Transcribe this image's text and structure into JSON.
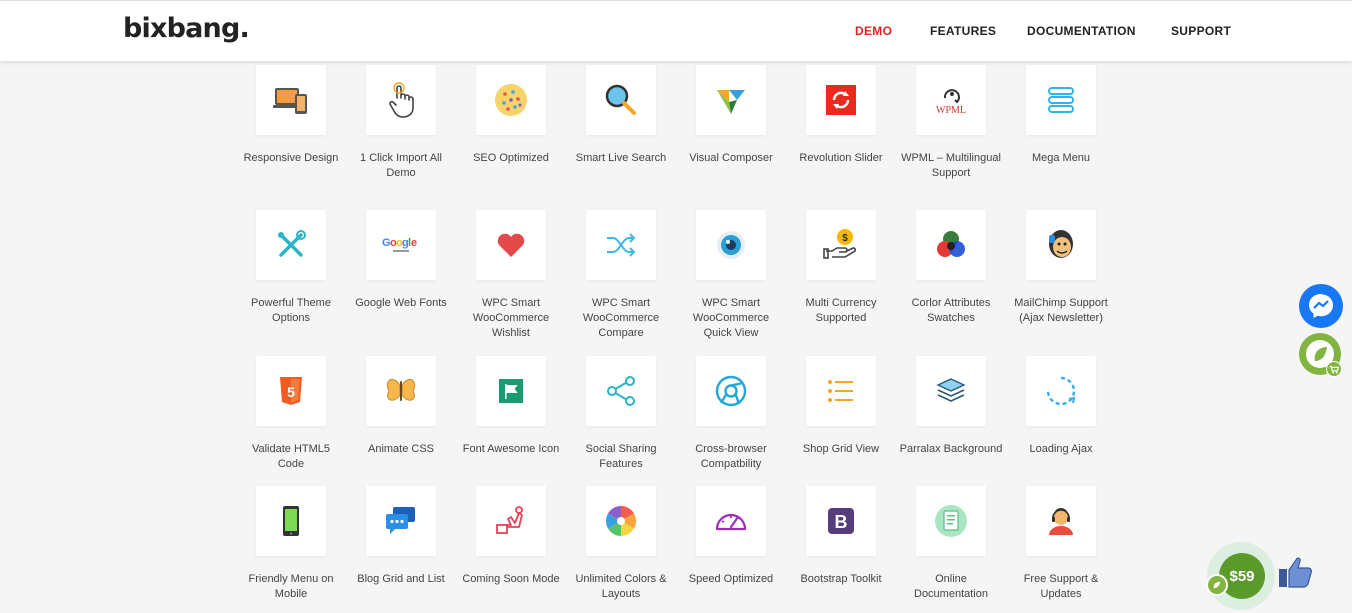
{
  "header": {
    "logo": "bixbang.",
    "nav": [
      "DEMO",
      "FEATURES",
      "DOCUMENTATION",
      "SUPPORT"
    ]
  },
  "features": [
    {
      "label": "Responsive Design",
      "icon": "responsive-icon"
    },
    {
      "label": "1 Click Import All Demo",
      "icon": "click-hand-icon"
    },
    {
      "label": "SEO Optimized",
      "icon": "seo-cookie-icon"
    },
    {
      "label": "Smart Live Search",
      "icon": "magnifier-icon"
    },
    {
      "label": "Visual Composer",
      "icon": "visual-composer-icon"
    },
    {
      "label": "Revolution Slider",
      "icon": "revolution-slider-icon"
    },
    {
      "label": "WPML – Multilingual Support",
      "icon": "wpml-icon"
    },
    {
      "label": "Mega Menu",
      "icon": "mega-menu-icon"
    },
    {
      "label": "Powerful Theme Options",
      "icon": "tools-icon"
    },
    {
      "label": "Google Web Fonts",
      "icon": "google-fonts-icon"
    },
    {
      "label": "WPC Smart WooCommerce Wishlist",
      "icon": "heart-icon"
    },
    {
      "label": "WPC Smart WooCommerce Compare",
      "icon": "shuffle-icon"
    },
    {
      "label": "WPC Smart WooCommerce Quick View",
      "icon": "eye-icon"
    },
    {
      "label": "Multi Currency Supported",
      "icon": "currency-icon"
    },
    {
      "label": "Corlor Attributes Swatches",
      "icon": "color-swatches-icon"
    },
    {
      "label": "MailChimp Support (Ajax Newsletter)",
      "icon": "mailchimp-icon"
    },
    {
      "label": "Validate HTML5 Code",
      "icon": "html5-icon"
    },
    {
      "label": "Animate CSS",
      "icon": "butterfly-icon"
    },
    {
      "label": "Font Awesome Icon",
      "icon": "flag-icon"
    },
    {
      "label": "Social Sharing Features",
      "icon": "share-icon"
    },
    {
      "label": "Cross-browser Compatbility",
      "icon": "browser-icon"
    },
    {
      "label": "Shop Grid View",
      "icon": "list-icon"
    },
    {
      "label": "Parralax Background",
      "icon": "layers-icon"
    },
    {
      "label": "Loading Ajax",
      "icon": "loading-icon"
    },
    {
      "label": "Friendly Menu on Mobile",
      "icon": "mobile-icon"
    },
    {
      "label": "Blog Grid and List",
      "icon": "chat-icon"
    },
    {
      "label": "Coming Soon Mode",
      "icon": "coming-soon-icon"
    },
    {
      "label": "Unlimited Colors & Layouts",
      "icon": "color-wheel-icon"
    },
    {
      "label": "Speed Optimized",
      "icon": "speedometer-icon"
    },
    {
      "label": "Bootstrap Toolkit",
      "icon": "bootstrap-icon"
    },
    {
      "label": "Online Documentation",
      "icon": "document-icon"
    },
    {
      "label": "Free Support & Updates",
      "icon": "support-agent-icon"
    }
  ],
  "widgets": {
    "price_badge": "$59"
  },
  "colors": {
    "accent": "#e02424",
    "envato_green": "#82b440",
    "messenger_blue": "#1877f2"
  }
}
